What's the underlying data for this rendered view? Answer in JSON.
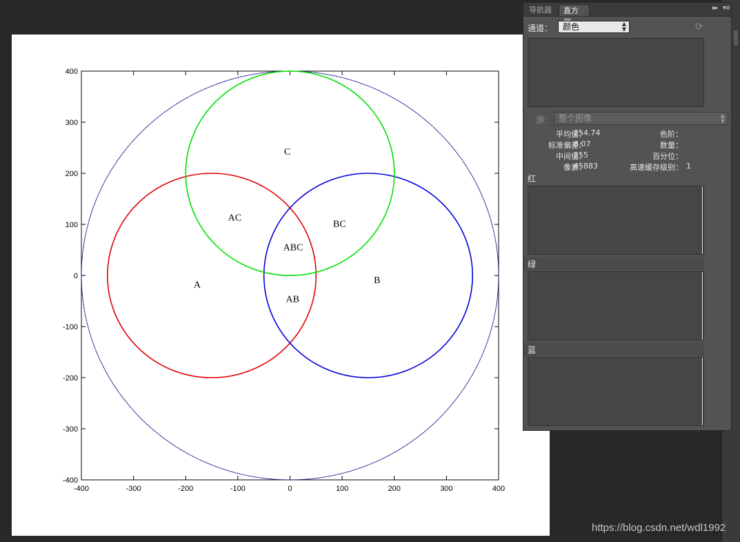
{
  "plot": {
    "x_ticks": [
      "-400",
      "-300",
      "-200",
      "-100",
      "0",
      "100",
      "200",
      "300",
      "400"
    ],
    "y_ticks": [
      "400",
      "300",
      "200",
      "100",
      "0",
      "-100",
      "-200",
      "-300",
      "-400"
    ],
    "xlim": [
      -400,
      400
    ],
    "ylim": [
      -400,
      400
    ],
    "circles": [
      {
        "name": "outer",
        "cx": 0,
        "cy": 0,
        "r": 400,
        "color": "#000080"
      },
      {
        "name": "A",
        "cx": -150,
        "cy": 0,
        "r": 200,
        "color": "#e00000"
      },
      {
        "name": "B",
        "cx": 150,
        "cy": 0,
        "r": 200,
        "color": "#0000dd"
      },
      {
        "name": "C",
        "cx": 0,
        "cy": 200,
        "r": 200,
        "color": "#00e000"
      }
    ],
    "regions": [
      {
        "text": "A",
        "x": -178,
        "y": -17
      },
      {
        "text": "B",
        "x": 167,
        "y": -8
      },
      {
        "text": "C",
        "x": -5,
        "y": 243
      },
      {
        "text": "AC",
        "x": -106,
        "y": 114
      },
      {
        "text": "BC",
        "x": 95,
        "y": 102
      },
      {
        "text": "ABC",
        "x": 6,
        "y": 56
      },
      {
        "text": "AB",
        "x": 5,
        "y": -45
      }
    ]
  },
  "panel": {
    "tabs": {
      "navigator": "导航器",
      "histogram": "直方图"
    },
    "tab_tools": {
      "collapse": "▸▸",
      "menu": "▾≡"
    },
    "channel_label": "通道：",
    "channel_value": "颜色",
    "source_label": "源：",
    "source_value": "整个图像",
    "stats": {
      "mean_label": "平均值：",
      "mean": "254.74",
      "std_label": "标准偏差：",
      "std": "8.07",
      "median_label": "中间值：",
      "median": "255",
      "pixels_label": "像素：",
      "pixels": "45883",
      "level_label": "色阶：",
      "level": "",
      "count_label": "数量：",
      "count": "",
      "percentile_label": "百分位：",
      "percentile": "",
      "cache_label": "高速缓存级别：",
      "cache": "1"
    },
    "channels": {
      "red": "红",
      "green": "绿",
      "blue": "蓝"
    },
    "icons": {
      "refresh": "⟳",
      "select_arrows": "▲▼"
    }
  },
  "watermark": "https://blog.csdn.net/wdl1992"
}
